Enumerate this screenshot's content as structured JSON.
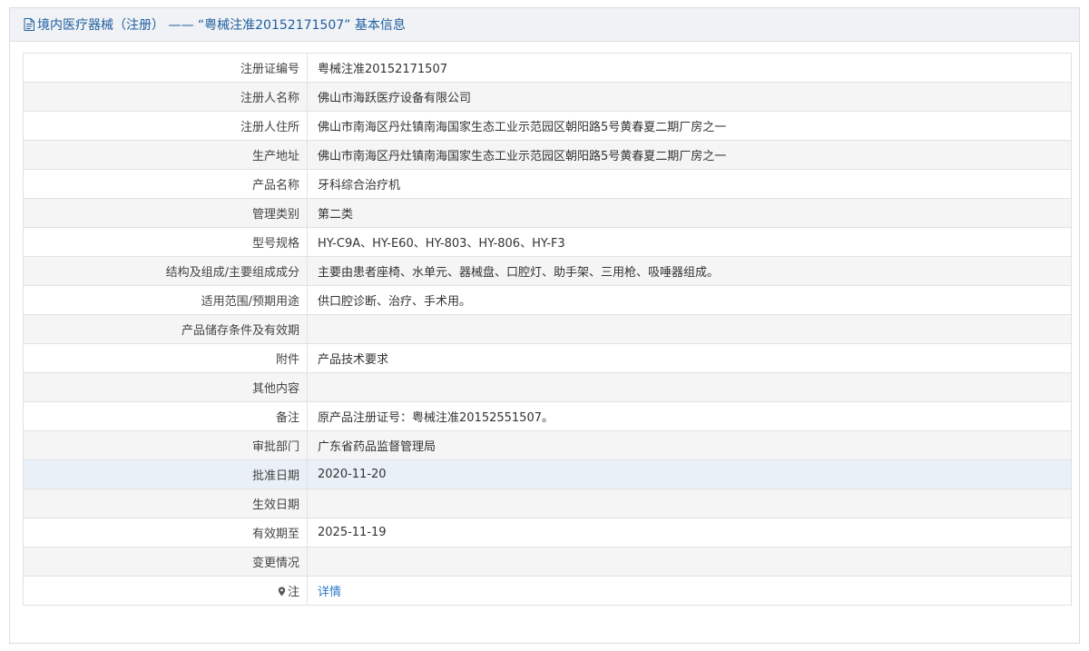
{
  "header": {
    "title": "境内医疗器械（注册） —— “粤械注准20152171507” 基本信息"
  },
  "rows": [
    {
      "label": "注册证编号",
      "value": "粤械注准20152171507"
    },
    {
      "label": "注册人名称",
      "value": "佛山市海跃医疗设备有限公司"
    },
    {
      "label": "注册人住所",
      "value": "佛山市南海区丹灶镇南海国家生态工业示范园区朝阳路5号黄春夏二期厂房之一"
    },
    {
      "label": "生产地址",
      "value": "佛山市南海区丹灶镇南海国家生态工业示范园区朝阳路5号黄春夏二期厂房之一"
    },
    {
      "label": "产品名称",
      "value": "牙科综合治疗机"
    },
    {
      "label": "管理类别",
      "value": "第二类"
    },
    {
      "label": "型号规格",
      "value": "HY-C9A、HY-E60、HY-803、HY-806、HY-F3"
    },
    {
      "label": "结构及组成/主要组成成分",
      "value": "主要由患者座椅、水单元、器械盘、口腔灯、助手架、三用枪、吸唾器组成。"
    },
    {
      "label": "适用范围/预期用途",
      "value": "供口腔诊断、治疗、手术用。"
    },
    {
      "label": "产品储存条件及有效期",
      "value": ""
    },
    {
      "label": "附件",
      "value": "产品技术要求"
    },
    {
      "label": "其他内容",
      "value": ""
    },
    {
      "label": "备注",
      "value": "原产品注册证号：粤械注准20152551507。"
    },
    {
      "label": "审批部门",
      "value": "广东省药品监督管理局"
    },
    {
      "label": "批准日期",
      "value": "2020-11-20"
    },
    {
      "label": "生效日期",
      "value": ""
    },
    {
      "label": "有效期至",
      "value": "2025-11-19"
    },
    {
      "label": "变更情况",
      "value": ""
    }
  ],
  "note": {
    "label": "注",
    "link_text": "详情",
    "icon": "pin-icon"
  },
  "colors": {
    "title": "#1f5fa0",
    "link": "#2a77c9",
    "row_alt": "#f5f5f5",
    "row_highlight": "#eaf0f7"
  }
}
